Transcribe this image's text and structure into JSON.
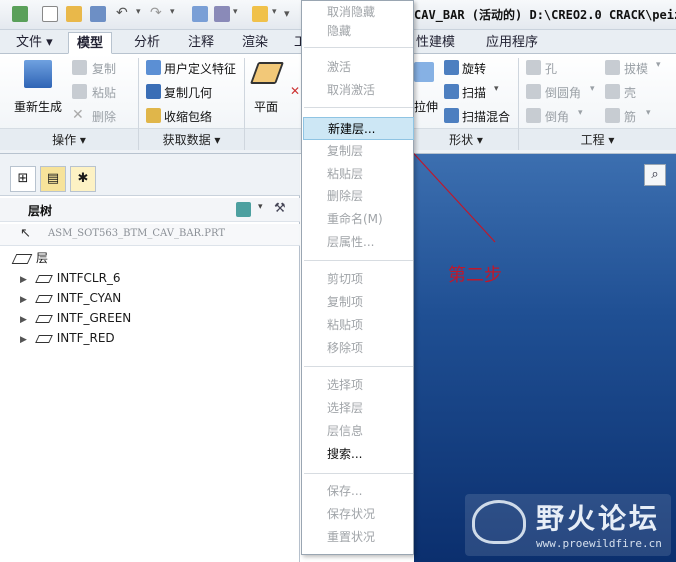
{
  "window": {
    "title_fragment": "CAV_BAR (活动的) D:\\CREO2.0 CRACK\\peiz"
  },
  "ribbon_tabs": [
    {
      "label": "文件 ▾",
      "active": false
    },
    {
      "label": "模型",
      "active": true
    },
    {
      "label": "分析",
      "active": false
    },
    {
      "label": "注释",
      "active": false
    },
    {
      "label": "渲染",
      "active": false
    },
    {
      "label": "工",
      "active": false
    },
    {
      "label": "性建模",
      "active": false
    },
    {
      "label": "应用程序",
      "active": false
    }
  ],
  "ribbon": {
    "regenerate_label": "重新生成",
    "copy_label": "复制",
    "paste_label": "粘贴",
    "delete_label": "删除",
    "user_defined_feature_label": "用户定义特征",
    "copy_geometry_label": "复制几何",
    "shrinkwrap_label": "收缩包络",
    "plane_label": "平面",
    "revolve_label": "旋转",
    "sweep_label": "扫描",
    "swept_blend_label": "扫描混合",
    "extrude_fragment": "拉伸",
    "hole_label": "孔",
    "draft_label": "拔模",
    "round_label": "倒圆角",
    "shell_label": "壳",
    "chamfer_label": "倒角",
    "rib_label": "筋",
    "groups": {
      "operations": "操作 ▾",
      "get_data": "获取数据 ▾",
      "shapes": "形状 ▾",
      "engineering": "工程 ▾"
    }
  },
  "panel": {
    "header_title": "层树",
    "path_text": "ASM_SOT563_BTM_CAV_BAR.PRT",
    "root_label": "层",
    "layers": [
      "INTFCLR_6",
      "INTF_CYAN",
      "INTF_GREEN",
      "INTF_RED"
    ]
  },
  "context_menu": {
    "items": [
      {
        "label": "取消隐藏",
        "enabled": false,
        "highlight": false
      },
      {
        "label": "隐藏",
        "enabled": false,
        "highlight": false
      },
      {
        "sep": true
      },
      {
        "label": "激活",
        "enabled": false,
        "highlight": false
      },
      {
        "label": "取消激活",
        "enabled": false,
        "highlight": false
      },
      {
        "sep": true
      },
      {
        "label": "新建层...",
        "enabled": true,
        "highlight": true
      },
      {
        "label": "复制层",
        "enabled": false,
        "highlight": false
      },
      {
        "label": "粘贴层",
        "enabled": false,
        "highlight": false
      },
      {
        "label": "删除层",
        "enabled": false,
        "highlight": false
      },
      {
        "label": "重命名(M)",
        "enabled": false,
        "highlight": false
      },
      {
        "label": "层属性...",
        "enabled": false,
        "highlight": false
      },
      {
        "sep": true
      },
      {
        "label": "剪切项",
        "enabled": false,
        "highlight": false
      },
      {
        "label": "复制项",
        "enabled": false,
        "highlight": false
      },
      {
        "label": "粘贴项",
        "enabled": false,
        "highlight": false
      },
      {
        "label": "移除项",
        "enabled": false,
        "highlight": false
      },
      {
        "sep": true
      },
      {
        "label": "选择项",
        "enabled": false,
        "highlight": false
      },
      {
        "label": "选择层",
        "enabled": false,
        "highlight": false
      },
      {
        "label": "层信息",
        "enabled": false,
        "highlight": false
      },
      {
        "label": "搜索...",
        "enabled": true,
        "highlight": false
      },
      {
        "sep": true
      },
      {
        "label": "保存...",
        "enabled": false,
        "highlight": false
      },
      {
        "label": "保存状况",
        "enabled": false,
        "highlight": false
      },
      {
        "label": "重置状况",
        "enabled": false,
        "highlight": false
      }
    ]
  },
  "annotation": {
    "text": "第二步",
    "color": "#c0182b"
  },
  "watermark": {
    "title": "野火论坛",
    "url": "www.proewildfire.cn"
  },
  "colors": {
    "accent_highlight": "#cde7f5",
    "viewport_top": "#3c6fb0",
    "viewport_bottom": "#0b2f6e"
  }
}
